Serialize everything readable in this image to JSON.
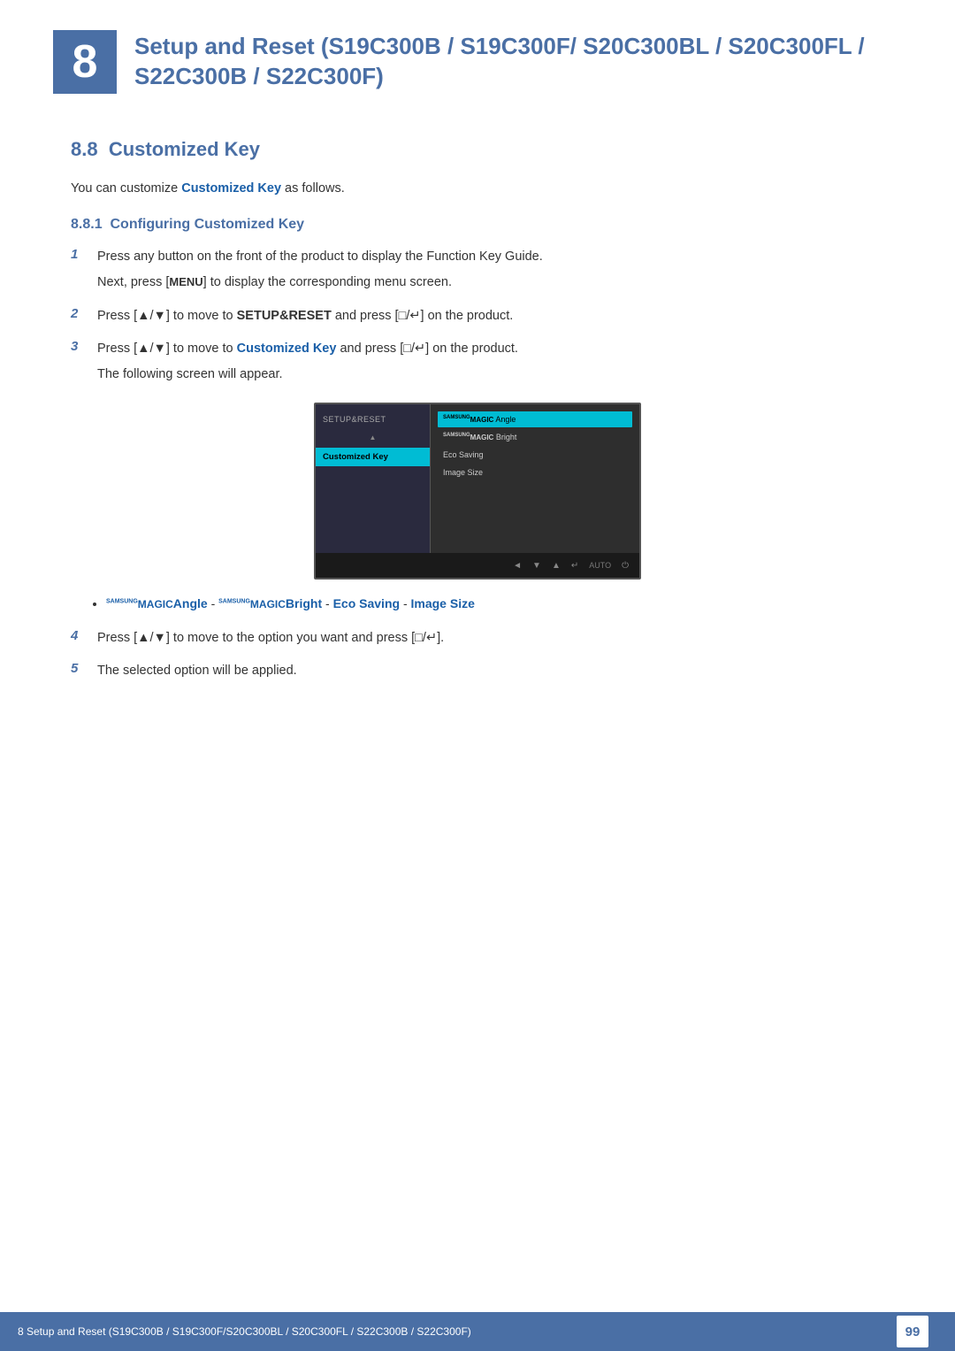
{
  "chapter": {
    "number": "8",
    "title": "Setup and Reset (S19C300B / S19C300F/ S20C300BL / S20C300FL / S22C300B / S22C300F)"
  },
  "section": {
    "number": "8.8",
    "title": "Customized Key"
  },
  "intro": {
    "text_before": "You can customize ",
    "highlight": "Customized Key",
    "text_after": " as follows."
  },
  "subsection": {
    "number": "8.8.1",
    "title": "Configuring Customized Key"
  },
  "steps": [
    {
      "num": "1",
      "text": "Press any button on the front of the product to display the Function Key Guide.",
      "sub": "Next, press [MENU] to display the corresponding menu screen."
    },
    {
      "num": "2",
      "text_parts": [
        "Press [▲/▼] to move to ",
        "SETUP&RESET",
        " and press [□/↵] on the product."
      ]
    },
    {
      "num": "3",
      "text_parts": [
        "Press [▲/▼] to move to ",
        "Customized Key",
        " and press [□/↵] on the product."
      ],
      "sub": "The following screen will appear."
    },
    {
      "num": "4",
      "text": "Press [▲/▼] to move to the option you want and press [□/↵]."
    },
    {
      "num": "5",
      "text": "The selected option will be applied."
    }
  ],
  "monitor": {
    "menu_title": "SETUP&RESET",
    "menu_arrow": "▲",
    "menu_item": "Customized Key",
    "options": [
      {
        "label": "SAMSUNG MAGIC Angle",
        "active": true
      },
      {
        "label": "SAMSUNG MAGIC Bright",
        "active": false
      },
      {
        "label": "Eco Saving",
        "active": false
      },
      {
        "label": "Image Size",
        "active": false
      }
    ],
    "bottom_icons": [
      "◄",
      "▼",
      "▲",
      "↵",
      "AUTO",
      "⏻"
    ]
  },
  "bullet_options": {
    "items": [
      {
        "parts": [
          {
            "type": "superscript",
            "text": "SAMSUNG"
          },
          {
            "type": "bold-blue",
            "text": "MAGIC"
          },
          {
            "type": "bold-blue",
            "text": "Angle"
          },
          {
            "type": "normal",
            "text": " - "
          },
          {
            "type": "superscript",
            "text": "SAMSUNG"
          },
          {
            "type": "bold-blue",
            "text": "MAGIC"
          },
          {
            "type": "bold-blue",
            "text": "Bright"
          },
          {
            "type": "normal",
            "text": " - "
          },
          {
            "type": "bold-blue",
            "text": "Eco Saving"
          },
          {
            "type": "normal",
            "text": " - "
          },
          {
            "type": "bold-blue",
            "text": "Image Size"
          }
        ]
      }
    ]
  },
  "footer": {
    "text": "8 Setup and Reset (S19C300B / S19C300F/S20C300BL / S20C300FL / S22C300B / S22C300F)",
    "page_number": "99"
  }
}
